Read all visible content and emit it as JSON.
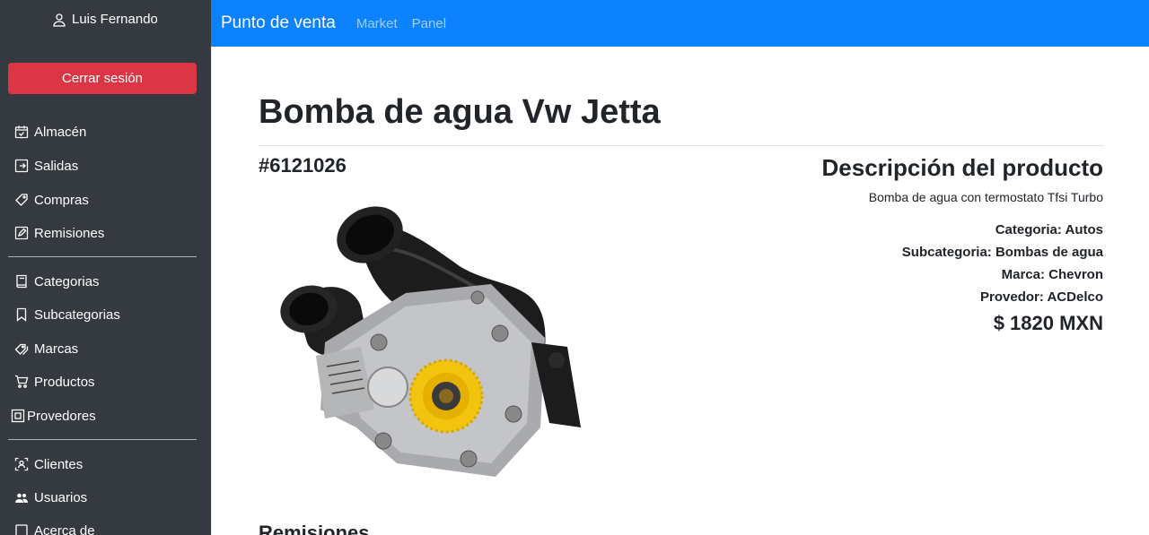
{
  "sidebar": {
    "user_name": "Luis Fernando",
    "logout_label": "Cerrar sesión",
    "group1": [
      {
        "label": "Almacén",
        "icon": "calendar-icon"
      },
      {
        "label": "Salidas",
        "icon": "exit-icon"
      },
      {
        "label": "Compras",
        "icon": "tag-icon"
      },
      {
        "label": "Remisiones",
        "icon": "edit-icon"
      }
    ],
    "group2": [
      {
        "label": "Categorias",
        "icon": "book-icon"
      },
      {
        "label": "Subcategorias",
        "icon": "bookmark-icon"
      },
      {
        "label": "Marcas",
        "icon": "tags-icon"
      },
      {
        "label": "Productos",
        "icon": "cart-icon"
      },
      {
        "label": "Provedores",
        "icon": "box-icon"
      }
    ],
    "group3": [
      {
        "label": "Clientes",
        "icon": "person-frame-icon"
      },
      {
        "label": "Usuarios",
        "icon": "people-icon"
      },
      {
        "label": "Acerca de",
        "icon": "square-icon"
      }
    ]
  },
  "navbar": {
    "brand": "Punto de venta",
    "links": [
      "Market",
      "Panel"
    ]
  },
  "product": {
    "title": "Bomba de agua Vw Jetta",
    "sku": "#6121026",
    "description_title": "Descripción del producto",
    "description": "Bomba de agua con termostato Tfsi Turbo",
    "category": "Categoria: Autos",
    "subcategory": "Subcategoria: Bombas de agua",
    "brand": "Marca: Chevron",
    "provider": "Provedor: ACDelco",
    "price": "$ 1820 MXN"
  },
  "sections": {
    "remisiones": "Remisiones"
  },
  "colors": {
    "navbar": "#0d82ff",
    "sidebar": "#343a40",
    "logout": "#dc3545"
  }
}
